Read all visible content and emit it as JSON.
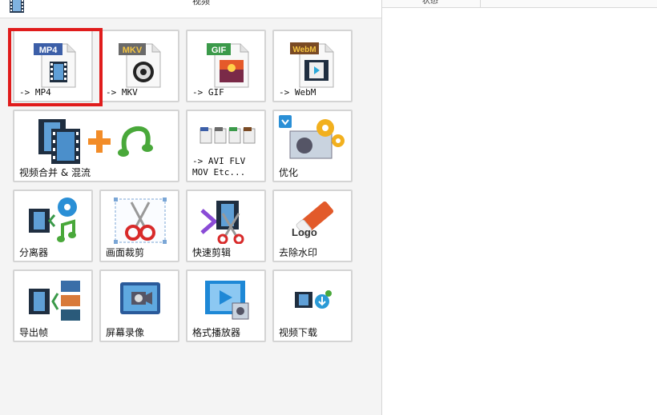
{
  "header": {
    "title": "视频",
    "icon": "film-icon"
  },
  "right_panel": {
    "column_label": "状态"
  },
  "tiles": {
    "mp4": {
      "badge": "MP4",
      "label": "-> MP4",
      "badge_color": "#3c5fa8",
      "icon": "mp4-file-icon"
    },
    "mkv": {
      "badge": "MKV",
      "label": "-> MKV",
      "badge_color": "#6a6a6a",
      "icon": "mkv-file-icon"
    },
    "gif": {
      "badge": "GIF",
      "label": "-> GIF",
      "badge_color": "#3b9a4a",
      "icon": "gif-file-icon"
    },
    "webm": {
      "badge": "WebM",
      "label": "-> WebM",
      "badge_color": "#7a4a24",
      "icon": "webm-file-icon"
    },
    "merge": {
      "label": "视频合并 & 混流",
      "icon": "video-merge-icon"
    },
    "other": {
      "label": "-> AVI FLV\nMOV Etc...",
      "icon": "other-formats-icon"
    },
    "optimize": {
      "label": "优化",
      "icon": "optimize-icon"
    },
    "splitter": {
      "label": "分离器",
      "icon": "splitter-icon"
    },
    "crop": {
      "label": "画面裁剪",
      "icon": "crop-icon"
    },
    "quickcut": {
      "label": "快速剪辑",
      "icon": "quick-cut-icon"
    },
    "logo": {
      "label": "去除水印",
      "logo_text": "Logo",
      "icon": "remove-watermark-icon"
    },
    "frames": {
      "label": "导出帧",
      "icon": "export-frames-icon"
    },
    "record": {
      "label": "屏幕录像",
      "icon": "screen-record-icon"
    },
    "player": {
      "label": "格式播放器",
      "icon": "format-player-icon"
    },
    "download": {
      "label": "视频下载",
      "icon": "video-download-icon"
    }
  },
  "colors": {
    "highlight": "#e01c1c",
    "tile_border": "#d4d4d4",
    "panel_bg": "#f4f4f4"
  }
}
